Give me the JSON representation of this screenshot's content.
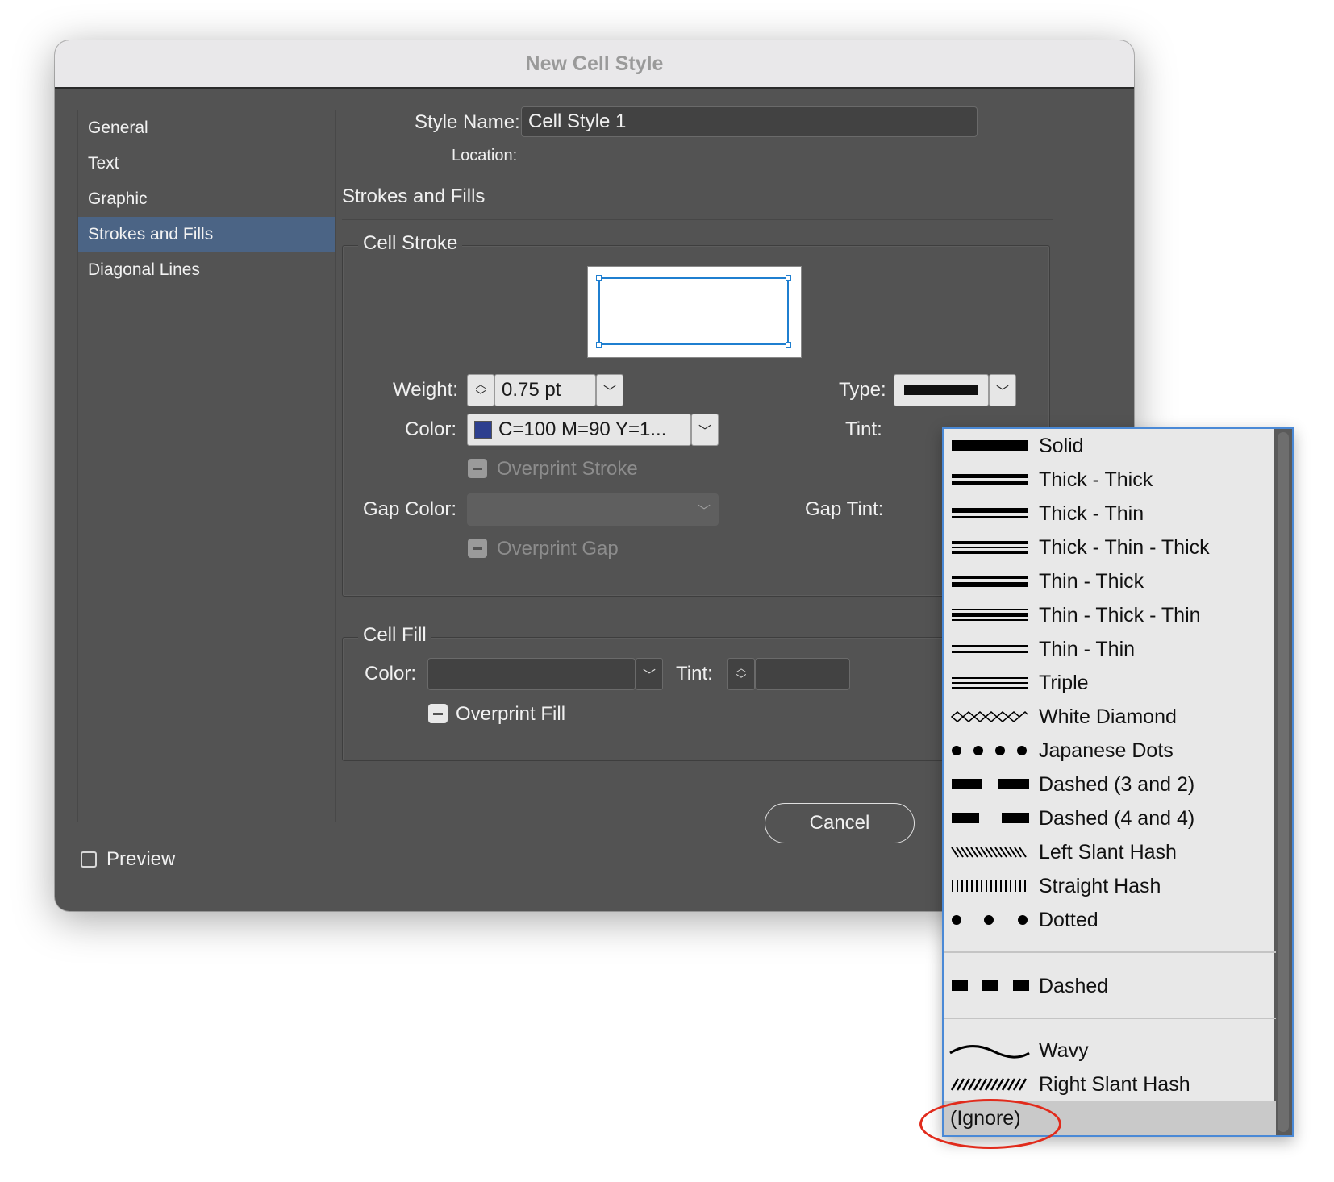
{
  "window": {
    "title": "New Cell Style"
  },
  "sidebar": {
    "items": [
      {
        "label": "General"
      },
      {
        "label": "Text"
      },
      {
        "label": "Graphic"
      },
      {
        "label": "Strokes and Fills",
        "selected": true
      },
      {
        "label": "Diagonal Lines"
      }
    ]
  },
  "header": {
    "style_name_label": "Style Name:",
    "style_name_value": "Cell Style 1",
    "location_label": "Location:",
    "section_title": "Strokes and Fills"
  },
  "cell_stroke": {
    "group_title": "Cell Stroke",
    "weight_label": "Weight:",
    "weight_value": "0.75 pt",
    "type_label": "Type:",
    "color_label": "Color:",
    "color_value": "C=100 M=90 Y=1...",
    "color_swatch": "#2d3f8f",
    "tint_label": "Tint:",
    "overprint_stroke_label": "Overprint Stroke",
    "gap_color_label": "Gap Color:",
    "gap_tint_label": "Gap Tint:",
    "overprint_gap_label": "Overprint Gap"
  },
  "cell_fill": {
    "group_title": "Cell Fill",
    "color_label": "Color:",
    "tint_label": "Tint:",
    "overprint_fill_label": "Overprint Fill"
  },
  "footer": {
    "preview_label": "Preview",
    "cancel_label": "Cancel"
  },
  "type_menu": {
    "items": [
      {
        "label": "Solid",
        "icon": "solid"
      },
      {
        "label": "Thick - Thick",
        "icon": "thick-thick"
      },
      {
        "label": "Thick - Thin",
        "icon": "thick-thin"
      },
      {
        "label": "Thick - Thin - Thick",
        "icon": "thick-thin-thick"
      },
      {
        "label": "Thin - Thick",
        "icon": "thin-thick"
      },
      {
        "label": "Thin - Thick - Thin",
        "icon": "thin-thick-thin"
      },
      {
        "label": "Thin - Thin",
        "icon": "thin-thin"
      },
      {
        "label": "Triple",
        "icon": "triple"
      },
      {
        "label": "White Diamond",
        "icon": "white-diamond"
      },
      {
        "label": "Japanese Dots",
        "icon": "japanese-dots"
      },
      {
        "label": "Dashed (3 and 2)",
        "icon": "dashed-3-2"
      },
      {
        "label": "Dashed (4 and 4)",
        "icon": "dashed-4-4"
      },
      {
        "label": "Left Slant Hash",
        "icon": "left-slant-hash"
      },
      {
        "label": "Straight Hash",
        "icon": "straight-hash"
      },
      {
        "label": "Dotted",
        "icon": "dotted"
      },
      {
        "label": "Dashed",
        "icon": "dashed"
      },
      {
        "label": "Wavy",
        "icon": "wavy"
      },
      {
        "label": "Right Slant Hash",
        "icon": "right-slant-hash"
      },
      {
        "label": "(Ignore)",
        "icon": "none",
        "highlighted": true
      }
    ]
  },
  "annotation": {
    "color": "#e12b1c"
  }
}
